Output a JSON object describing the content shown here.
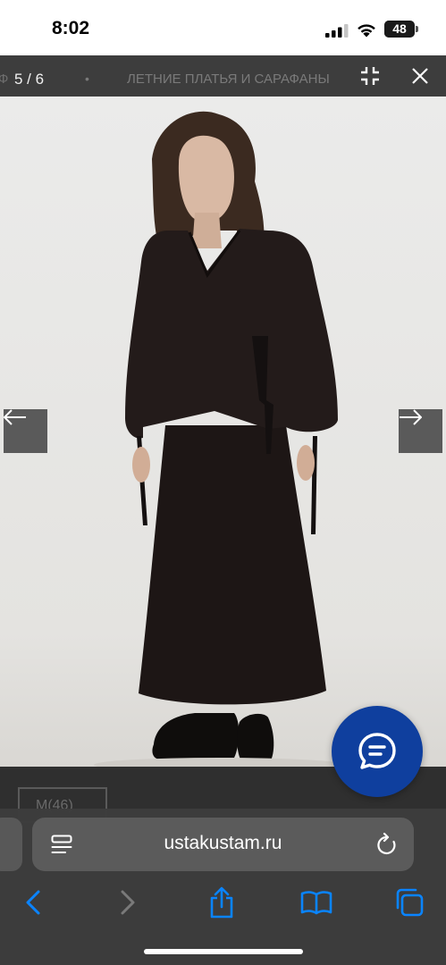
{
  "status": {
    "time": "8:02",
    "battery_percent": 48,
    "battery_text": "48"
  },
  "gallery": {
    "counter": "5 / 6",
    "crumb_left": "Ф",
    "crumb_separator": "•",
    "crumb_title": "ЛЕТНИЕ ПЛАТЬЯ И САРАФАНЫ",
    "icons": {
      "fullscreen": "exit-fullscreen-icon",
      "close": "close-icon",
      "prev": "arrow-left-icon",
      "next": "arrow-right-icon"
    }
  },
  "product": {
    "size_label": "M(46)"
  },
  "chat": {
    "icon": "chat-bubble-icon",
    "color": "#0f3f9e"
  },
  "browser": {
    "url": "ustakustam.ru",
    "accent": "#0a84ff",
    "icons": {
      "page_menu": "page-menu-icon",
      "reload": "reload-icon",
      "back": "chevron-left-icon",
      "forward": "chevron-right-icon",
      "share": "share-icon",
      "bookmarks": "book-icon",
      "tabs": "tabs-icon"
    }
  }
}
